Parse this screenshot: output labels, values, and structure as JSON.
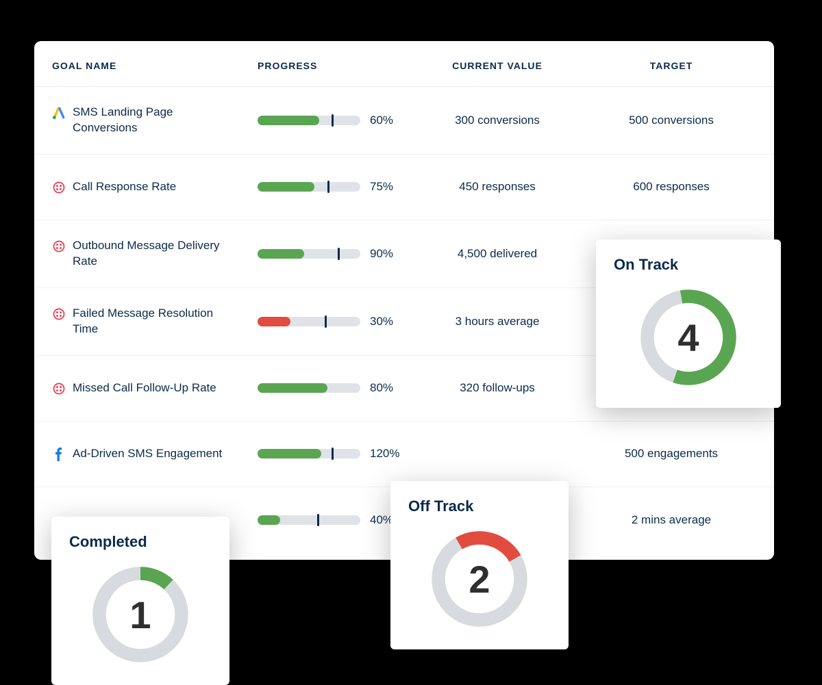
{
  "headers": {
    "name": "GOAL NAME",
    "progress": "PROGRESS",
    "current": "CURRENT VALUE",
    "target": "TARGET"
  },
  "rows": [
    {
      "icon": "google-ads",
      "name": "SMS Landing Page Conversions",
      "pct": "60%",
      "fill": 60,
      "marker": 72,
      "color": "green",
      "current": "300 conversions",
      "target": "500 conversions"
    },
    {
      "icon": "twilio",
      "name": "Call Response Rate",
      "pct": "75%",
      "fill": 55,
      "marker": 68,
      "color": "green",
      "current": "450 responses",
      "target": "600 responses"
    },
    {
      "icon": "twilio",
      "name": "Outbound Message Delivery Rate",
      "pct": "90%",
      "fill": 45,
      "marker": 78,
      "color": "green",
      "current": "4,500 delivered",
      "target": ""
    },
    {
      "icon": "twilio",
      "name": "Failed Message Resolution Time",
      "pct": "30%",
      "fill": 32,
      "marker": 65,
      "color": "red",
      "current": "3 hours average",
      "target": ""
    },
    {
      "icon": "twilio",
      "name": "Missed Call Follow-Up Rate",
      "pct": "80%",
      "fill": 68,
      "marker": 0,
      "color": "green",
      "current": "320 follow-ups",
      "target": ""
    },
    {
      "icon": "facebook",
      "name": "Ad-Driven SMS Engagement",
      "pct": "120%",
      "fill": 62,
      "marker": 72,
      "color": "green",
      "current": "",
      "target": "500 engagements"
    },
    {
      "icon": "",
      "name": "",
      "pct": "40%",
      "fill": 22,
      "marker": 58,
      "color": "green",
      "current": "",
      "target": "2 mins average"
    }
  ],
  "summary": {
    "completed": {
      "title": "Completed",
      "value": "1",
      "fraction": 0.12,
      "color": "#5aa552",
      "start": 0
    },
    "offtrack": {
      "title": "Off Track",
      "value": "2",
      "fraction": 0.25,
      "color": "#e24c3f",
      "start": -30
    },
    "ontrack": {
      "title": "On Track",
      "value": "4",
      "fraction": 0.58,
      "color": "#5aa552",
      "start": -10
    }
  },
  "chart_data": {
    "type": "table",
    "columns": [
      "Goal Name",
      "Progress %",
      "Current Value",
      "Target"
    ],
    "rows": [
      [
        "SMS Landing Page Conversions",
        60,
        "300 conversions",
        "500 conversions"
      ],
      [
        "Call Response Rate",
        75,
        "450 responses",
        "600 responses"
      ],
      [
        "Outbound Message Delivery Rate",
        90,
        "4,500 delivered",
        null
      ],
      [
        "Failed Message Resolution Time",
        30,
        "3 hours average",
        null
      ],
      [
        "Missed Call Follow-Up Rate",
        80,
        "320 follow-ups",
        null
      ],
      [
        "Ad-Driven SMS Engagement",
        120,
        null,
        "500 engagements"
      ],
      [
        null,
        40,
        null,
        "2 mins average"
      ]
    ],
    "summary_donuts": [
      {
        "label": "Completed",
        "value": 1
      },
      {
        "label": "Off Track",
        "value": 2
      },
      {
        "label": "On Track",
        "value": 4
      }
    ]
  }
}
